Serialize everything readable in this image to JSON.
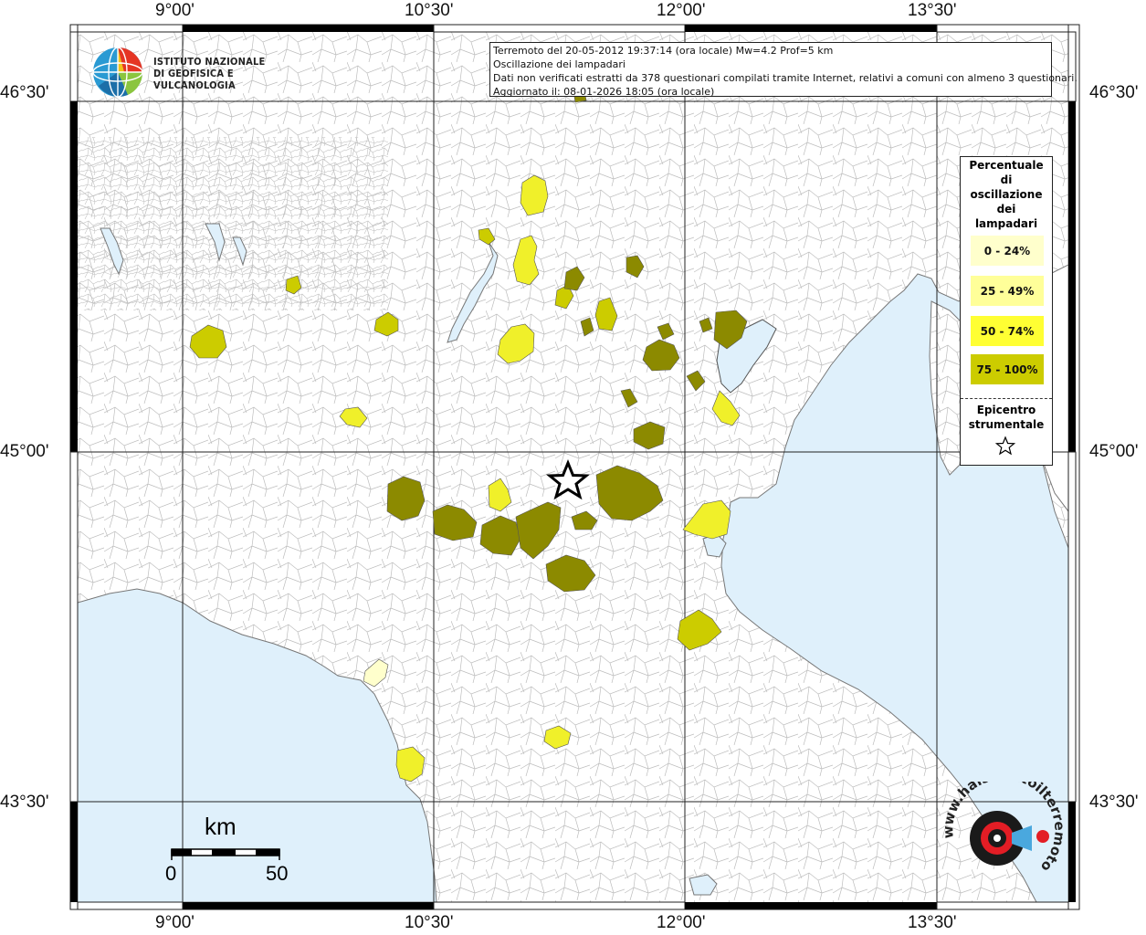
{
  "coords": {
    "top": [
      "9°00'",
      "10°30'",
      "12°00'",
      "13°30'"
    ],
    "bottom": [
      "9°00'",
      "10°30'",
      "12°00'",
      "13°30'"
    ],
    "left": [
      "46°30'",
      "45°00'",
      "43°30'"
    ],
    "right": [
      "46°30'",
      "45°00'",
      "43°30'"
    ]
  },
  "logo": {
    "line1": "ISTITUTO NAZIONALE",
    "line2": "DI GEOFISICA E VULCANOLOGIA"
  },
  "info": {
    "line1": "Terremoto del 20-05-2012 19:37:14 (ora locale) Mw=4.2 Prof=5 km",
    "line2": "Oscillazione dei lampadari",
    "line3": "Dati non verificati estratti da 378 questionari compilati tramite Internet, relativi a comuni con almeno 3 questionari.",
    "line4": "Aggiornato il: 08-01-2026 18:05 (ora locale)"
  },
  "legend": {
    "title_lines": [
      "Percentuale",
      "di",
      "oscillazione",
      "dei",
      "lampadari"
    ],
    "items": [
      {
        "label": "0 - 24%",
        "color": "#ffffcc"
      },
      {
        "label": "25 - 49%",
        "color": "#ffff99"
      },
      {
        "label": "50 - 74%",
        "color": "#ffff33"
      },
      {
        "label": "75 - 100%",
        "color": "#cccc00"
      }
    ],
    "epicenter_lines": [
      "Epicentro",
      "strumentale"
    ]
  },
  "scale": {
    "unit": "km",
    "start": "0",
    "end": "50"
  },
  "stamp": {
    "text": "www.haisentitoilterremoto.it"
  },
  "colors": {
    "sea": "#dff0fb",
    "land": "#ffffff",
    "boundary": "#b8b8b8",
    "dark_olive": "#8c8a00",
    "olive": "#cccc00",
    "yellow": "#f5f51e",
    "light_yellow": "#fafa9a",
    "pale": "#ffffcc"
  }
}
